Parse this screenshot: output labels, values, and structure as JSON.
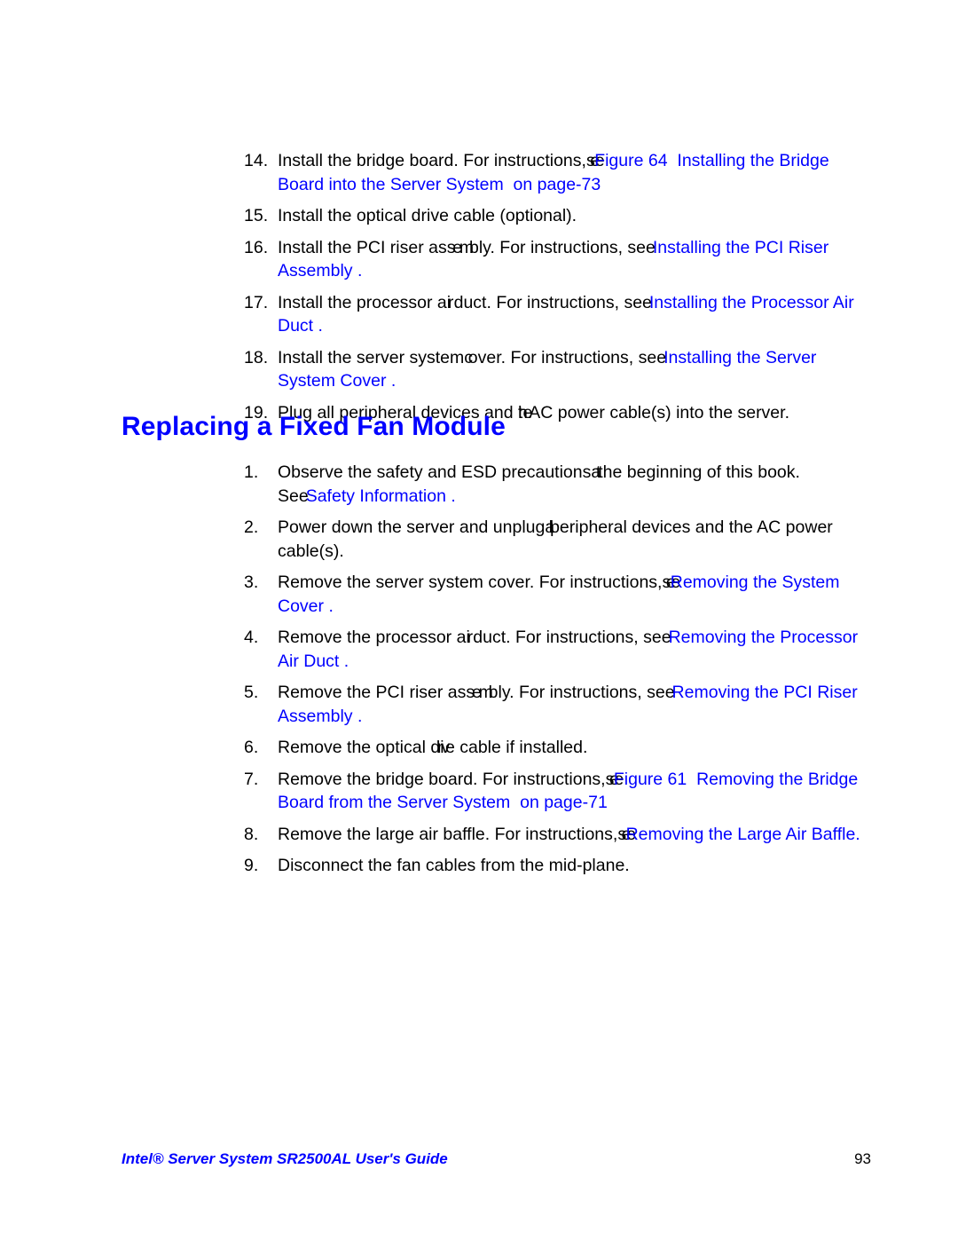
{
  "document": {
    "title": "Intel® Server System SR2500AL User's Guide",
    "page_number": "93",
    "link_color": "#0000FF",
    "body_color": "#000000"
  },
  "top_list": {
    "items": [
      {
        "number": "14.",
        "lead": "Install the bridge board. For instructions,",
        "see": "see",
        "ref_a": "Figure 64",
        "ref_b": "Installing the Bridge Board into the Server System",
        "ref_c": "on page",
        "ref_d": "-73",
        "trail": ""
      },
      {
        "number": "15.",
        "lead": "Install the optical drive cable (optional).",
        "see": "",
        "ref_a": "",
        "ref_b": "",
        "ref_c": "",
        "ref_d": "",
        "trail": ""
      },
      {
        "number": "16.",
        "lead_pre": "Install the PCI riser as",
        "lead_squeeze": "sem",
        "lead_post": "bly. For instructions, see",
        "ref_b": "Installing the PCI Riser Assembly",
        "trail": "."
      },
      {
        "number": "17.",
        "lead_pre": "Install the processor a",
        "lead_squeeze": "ir",
        "lead_post": " duct. For instructions, see",
        "ref_b": "Installing the Processor Air Duct",
        "trail": "."
      },
      {
        "number": "18.",
        "lead_pre": "Install the server system",
        "lead_squeeze": " c",
        "lead_post": "over. For instructions, see",
        "ref_b": "Installing the Server System Cover",
        "trail": "."
      },
      {
        "number": "19.",
        "lead_pre": "Plug all peripheral devices and ",
        "lead_squeeze": "the",
        "lead_post": " AC power cable(s) into the server.",
        "ref_b": "",
        "trail": ""
      }
    ]
  },
  "section": {
    "heading": "Replacing a Fixed Fan Module"
  },
  "steps_list": {
    "items": [
      {
        "number": "1.",
        "lead_pre": "Observe the safety and ESD precautions",
        "lead_squeeze": " at",
        "lead_post": " the beginning of this book. See",
        "ref_b": "Safety Information",
        "trail": "."
      },
      {
        "number": "2.",
        "lead_pre": "Power down the server and unplug",
        "lead_squeeze": " all",
        "lead_post": " peripheral devices and the AC power cable(s).",
        "ref_b": "",
        "trail": ""
      },
      {
        "number": "3.",
        "lead_pre": "Remove the server system cover. For instructions,",
        "lead_squeeze": " see",
        "lead_post": "",
        "ref_b": "Removing the System Cover",
        "trail": "."
      },
      {
        "number": "4.",
        "lead_pre": "Remove the processor a",
        "lead_squeeze": "ir",
        "lead_post": " duct. For instructions, see",
        "ref_b": "Removing the Processor Air Duct",
        "trail": "."
      },
      {
        "number": "5.",
        "lead_pre": "Remove the PCI riser as",
        "lead_squeeze": "sem",
        "lead_post": "bly. For instructions, see",
        "ref_b": "Removing the PCI Riser Assembly",
        "trail": "."
      },
      {
        "number": "6.",
        "lead_pre": "Remove the optical ",
        "lead_squeeze": "driv",
        "lead_post": "e cable if installed.",
        "ref_b": "",
        "trail": ""
      },
      {
        "number": "7.",
        "lead_pre": "Remove the bridge board. For instructions,",
        "lead_squeeze": " see",
        "lead_post": "",
        "ref_a": "Figure 61",
        "ref_b": "Removing the Bridge Board from the Server System",
        "ref_c": "on page",
        "ref_d": "-71",
        "trail": ""
      },
      {
        "number": "8.",
        "lead_pre": "Remove the large air baffle. For instructions,",
        "lead_squeeze": " see",
        "lead_post": "",
        "ref_b": "Removing the Large Air Baffle",
        "trail": "."
      },
      {
        "number": "9.",
        "lead_pre": "Disconnect the fan cables from the mid-plane.",
        "lead_squeeze": "",
        "lead_post": "",
        "ref_b": "",
        "trail": ""
      }
    ]
  }
}
